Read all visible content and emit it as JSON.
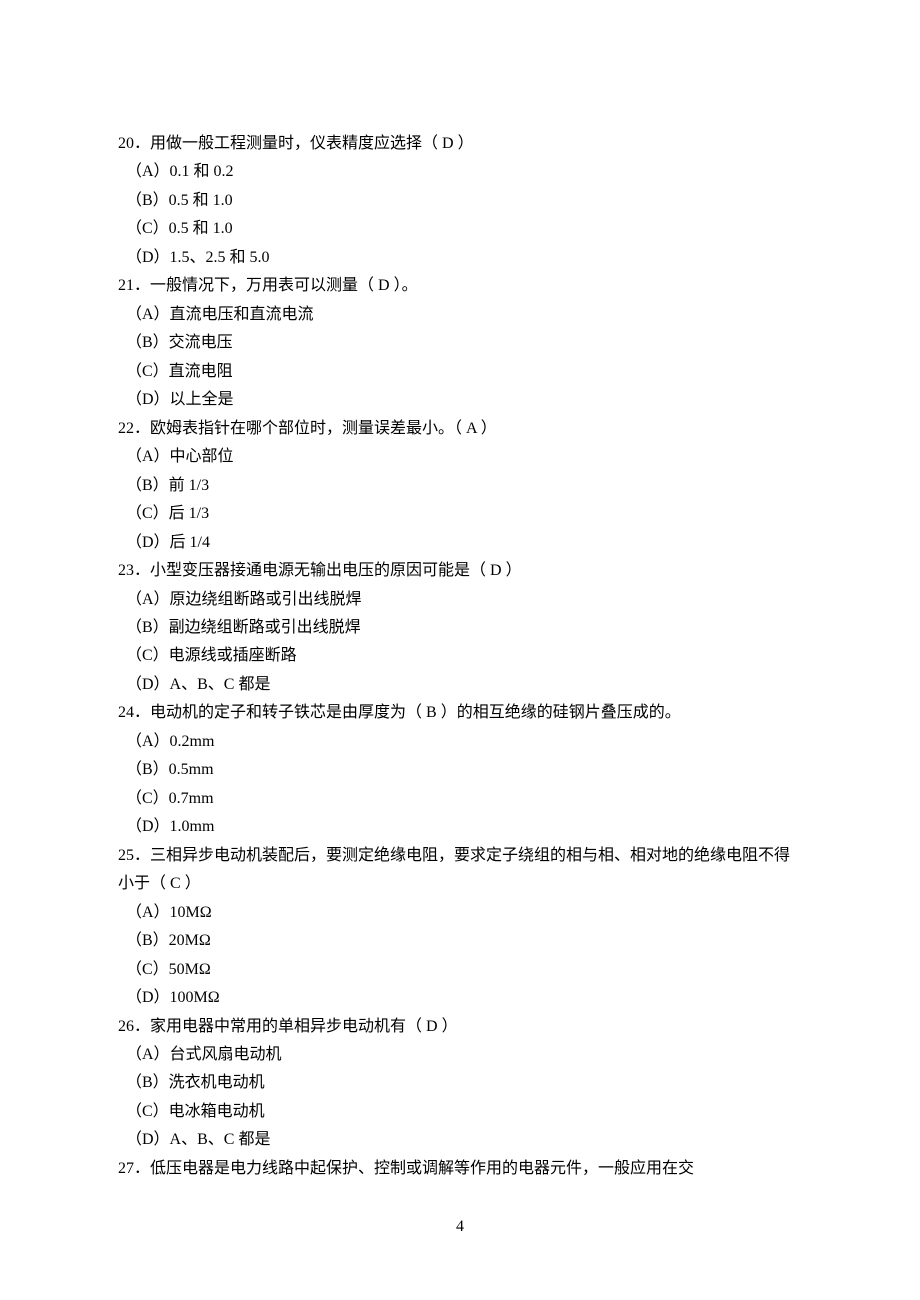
{
  "page_number": "4",
  "questions": [
    {
      "num": "20．",
      "stem_pre": "用做一般工程测量时，仪表精度应选择（",
      "answer": "  D  ",
      "stem_post": "）",
      "opts": [
        "（A）0.1 和 0.2",
        "（B）0.5 和 1.0",
        "（C）0.5 和 1.0",
        "（D）1.5、2.5 和 5.0"
      ]
    },
    {
      "num": "21．",
      "stem_pre": "一般情况下，万用表可以测量（",
      "answer": "  D  ",
      "stem_post": "）。",
      "opts": [
        "（A）直流电压和直流电流",
        "（B）交流电压",
        "（C）直流电阻",
        "（D）以上全是"
      ]
    },
    {
      "num": "22．",
      "stem_pre": "欧姆表指针在哪个部位时，测量误差最小。（  ",
      "answer": " A  ",
      "stem_post": " ）",
      "opts": [
        "（A）中心部位",
        "（B）前 1/3",
        "（C）后 1/3",
        "（D）后 1/4"
      ]
    },
    {
      "num": "23．",
      "stem_pre": "小型变压器接通电源无输出电压的原因可能是（  ",
      "answer": " D  ",
      "stem_post": " ）",
      "opts": [
        "（A）原边绕组断路或引出线脱焊",
        "（B）副边绕组断路或引出线脱焊",
        "（C）电源线或插座断路",
        "（D）A、B、C 都是"
      ]
    },
    {
      "num": "24．",
      "stem_pre": "电动机的定子和转子铁芯是由厚度为（  ",
      "answer": " B  ",
      "stem_post": " ）的相互绝缘的硅钢片叠压成的。",
      "opts": [
        "（A）0.2mm",
        "（B）0.5mm",
        "（C）0.7mm",
        "（D）1.0mm"
      ]
    },
    {
      "num": "25．",
      "stem_pre": "三相异步电动机装配后，要测定绝缘电阻，要求定子绕组的相与相、相对地的绝缘电阻不得小于（",
      "answer": " C ",
      "stem_post": " ）",
      "wrap": true,
      "opts": [
        "（A）10MΩ",
        "（B）20MΩ",
        "（C）50MΩ",
        "（D）100MΩ"
      ]
    },
    {
      "num": "26．",
      "stem_pre": "家用电器中常用的单相异步电动机有（  ",
      "answer": " D  ",
      "stem_post": "  ）",
      "opts": [
        "（A）台式风扇电动机",
        "（B）洗衣机电动机",
        "（C）电冰箱电动机",
        "（D）A、B、C 都是"
      ]
    },
    {
      "num": "27．",
      "stem_pre": "低压电器是电力线路中起保护、控制或调解等作用的电器元件，一般应用在交",
      "answer": "",
      "stem_post": "",
      "opts": []
    }
  ]
}
